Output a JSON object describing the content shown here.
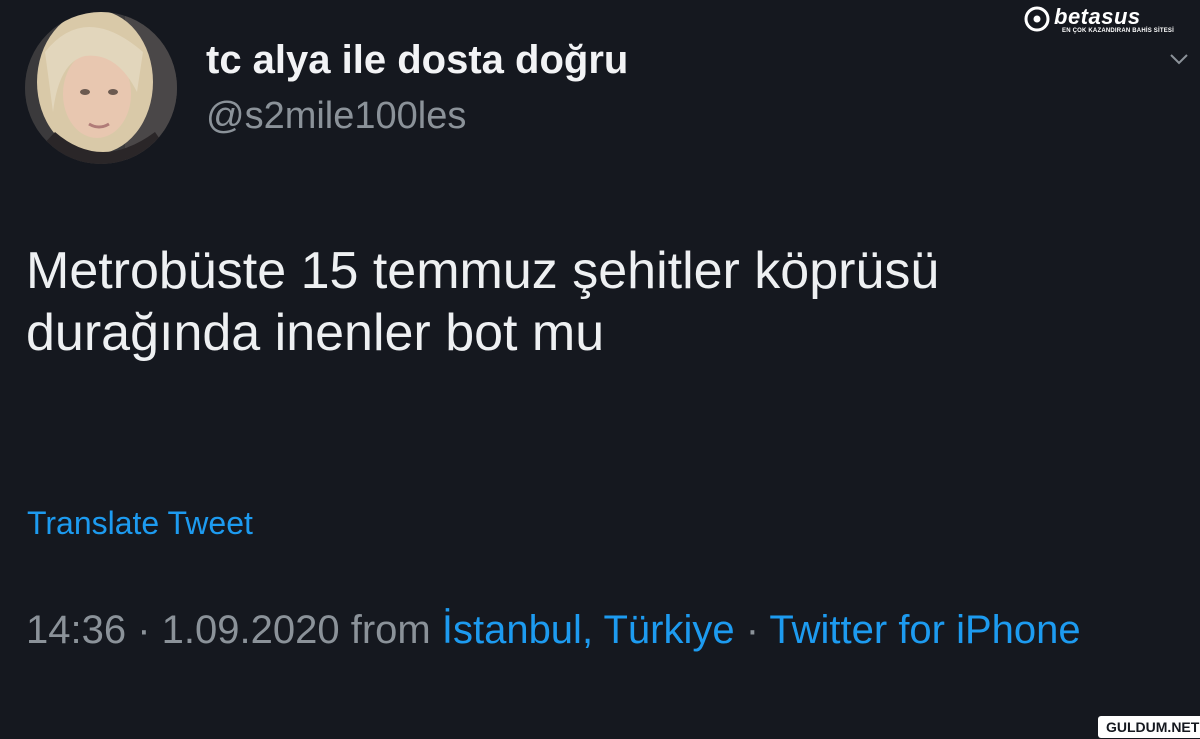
{
  "user": {
    "display_name": "tc alya ile dosta doğru",
    "handle": "@s2mile100les"
  },
  "tweet": {
    "text_lines": [
      "Metrobüste 15 temmuz şehitler köprüsü",
      "durağında inenler bot mu"
    ],
    "translate_label": "Translate Tweet"
  },
  "meta": {
    "time": "14:36",
    "separator": " · ",
    "date": "1.09.2020",
    "from_label": " from ",
    "location": "İstanbul, Türkiye",
    "client": "Twitter for iPhone"
  },
  "watermarks": {
    "brand": "betasus",
    "brand_tagline": "EN ÇOK KAZANDIRAN BAHİS SİTESİ",
    "site": "GULDUM.NET"
  },
  "icons": {
    "menu": "chevron-down-icon",
    "avatar": "profile-photo"
  },
  "colors": {
    "background": "#15181f",
    "primary_text": "#eef0f2",
    "secondary_text": "#8b9299",
    "link": "#1d9bf0"
  }
}
